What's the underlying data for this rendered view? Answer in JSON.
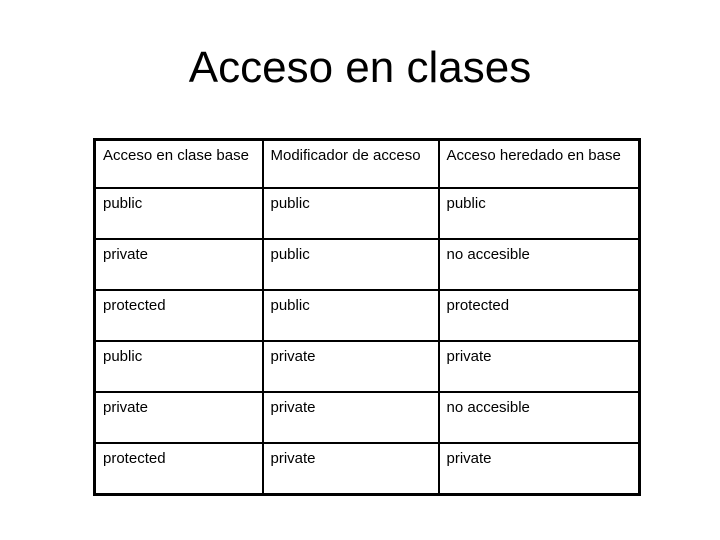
{
  "title": "Acceso en clases",
  "table": {
    "headers": [
      "Acceso en clase base",
      "Modificador de acceso",
      "Acceso heredado en base"
    ],
    "rows": [
      [
        "public",
        "public",
        "public"
      ],
      [
        "private",
        "public",
        "no accesible"
      ],
      [
        "protected",
        "public",
        "protected"
      ],
      [
        "public",
        "private",
        "private"
      ],
      [
        "private",
        "private",
        "no accesible"
      ],
      [
        "protected",
        "private",
        "private"
      ]
    ]
  }
}
